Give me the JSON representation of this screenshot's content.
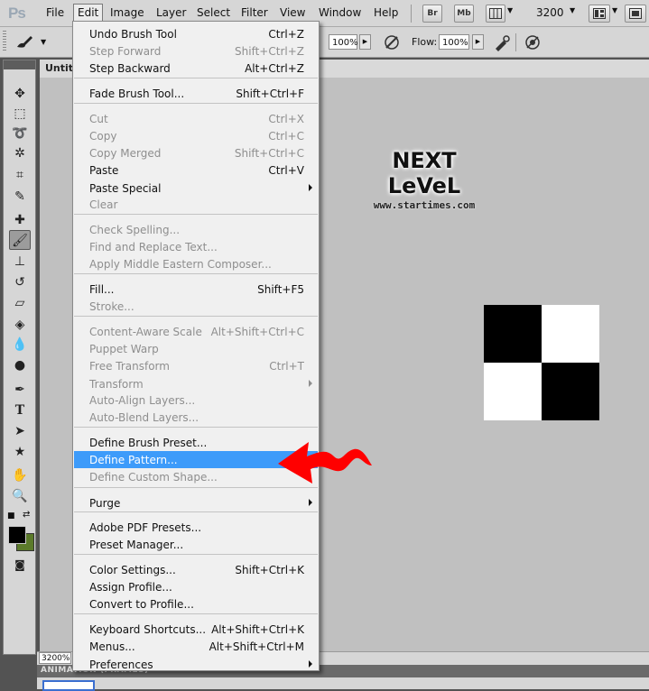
{
  "app": {
    "logo": "Ps"
  },
  "menubar": {
    "items": [
      "File",
      "Edit",
      "Image",
      "Layer",
      "Select",
      "Filter",
      "View",
      "Window",
      "Help"
    ],
    "bridge_button": "Br",
    "minibridge_button": "Mb",
    "zoom_value": "3200"
  },
  "options_bar": {
    "opacity_value": "100%",
    "flow_label": "Flow:",
    "flow_value": "100%"
  },
  "document": {
    "tab_title": "Untitl",
    "zoom_status": "3200%"
  },
  "watermark": {
    "title": "NEXT LeVeL",
    "url": "www.startimes.com"
  },
  "panel": {
    "tab_label": "ANIMATION (FRAMES)"
  },
  "edit_menu": {
    "items": [
      {
        "label": "Undo Brush Tool",
        "shortcut": "Ctrl+Z",
        "enabled": true,
        "submenu": false
      },
      {
        "label": "Step Forward",
        "shortcut": "Shift+Ctrl+Z",
        "enabled": false,
        "submenu": false
      },
      {
        "label": "Step Backward",
        "shortcut": "Alt+Ctrl+Z",
        "enabled": true,
        "submenu": false
      },
      {
        "label": "Fade Brush Tool...",
        "shortcut": "Shift+Ctrl+F",
        "enabled": true,
        "submenu": false
      },
      {
        "label": "Cut",
        "shortcut": "Ctrl+X",
        "enabled": false,
        "submenu": false
      },
      {
        "label": "Copy",
        "shortcut": "Ctrl+C",
        "enabled": false,
        "submenu": false
      },
      {
        "label": "Copy Merged",
        "shortcut": "Shift+Ctrl+C",
        "enabled": false,
        "submenu": false
      },
      {
        "label": "Paste",
        "shortcut": "Ctrl+V",
        "enabled": true,
        "submenu": false
      },
      {
        "label": "Paste Special",
        "shortcut": "",
        "enabled": true,
        "submenu": true
      },
      {
        "label": "Clear",
        "shortcut": "",
        "enabled": false,
        "submenu": false
      },
      {
        "label": "Check Spelling...",
        "shortcut": "",
        "enabled": false,
        "submenu": false
      },
      {
        "label": "Find and Replace Text...",
        "shortcut": "",
        "enabled": false,
        "submenu": false
      },
      {
        "label": "Apply Middle Eastern Composer...",
        "shortcut": "",
        "enabled": false,
        "submenu": false
      },
      {
        "label": "Fill...",
        "shortcut": "Shift+F5",
        "enabled": true,
        "submenu": false
      },
      {
        "label": "Stroke...",
        "shortcut": "",
        "enabled": false,
        "submenu": false
      },
      {
        "label": "Content-Aware Scale",
        "shortcut": "Alt+Shift+Ctrl+C",
        "enabled": false,
        "submenu": false
      },
      {
        "label": "Puppet Warp",
        "shortcut": "",
        "enabled": false,
        "submenu": false
      },
      {
        "label": "Free Transform",
        "shortcut": "Ctrl+T",
        "enabled": false,
        "submenu": false
      },
      {
        "label": "Transform",
        "shortcut": "",
        "enabled": false,
        "submenu": true
      },
      {
        "label": "Auto-Align Layers...",
        "shortcut": "",
        "enabled": false,
        "submenu": false
      },
      {
        "label": "Auto-Blend Layers...",
        "shortcut": "",
        "enabled": false,
        "submenu": false
      },
      {
        "label": "Define Brush Preset...",
        "shortcut": "",
        "enabled": true,
        "submenu": false
      },
      {
        "label": "Define Pattern...",
        "shortcut": "",
        "enabled": true,
        "submenu": false,
        "highlighted": true
      },
      {
        "label": "Define Custom Shape...",
        "shortcut": "",
        "enabled": false,
        "submenu": false
      },
      {
        "label": "Purge",
        "shortcut": "",
        "enabled": true,
        "submenu": true
      },
      {
        "label": "Adobe PDF Presets...",
        "shortcut": "",
        "enabled": true,
        "submenu": false
      },
      {
        "label": "Preset Manager...",
        "shortcut": "",
        "enabled": true,
        "submenu": false
      },
      {
        "label": "Color Settings...",
        "shortcut": "Shift+Ctrl+K",
        "enabled": true,
        "submenu": false
      },
      {
        "label": "Assign Profile...",
        "shortcut": "",
        "enabled": true,
        "submenu": false
      },
      {
        "label": "Convert to Profile...",
        "shortcut": "",
        "enabled": true,
        "submenu": false
      },
      {
        "label": "Keyboard Shortcuts...",
        "shortcut": "Alt+Shift+Ctrl+K",
        "enabled": true,
        "submenu": false
      },
      {
        "label": "Menus...",
        "shortcut": "Alt+Shift+Ctrl+M",
        "enabled": true,
        "submenu": false
      },
      {
        "label": "Preferences",
        "shortcut": "",
        "enabled": true,
        "submenu": true
      }
    ]
  },
  "colors": {
    "highlight": "#3d9bfa",
    "foreground_swatch": "#000000",
    "background_swatch": "#5b7a2a",
    "annotation_arrow": "#ff0000"
  },
  "icons": {
    "toolbox": [
      "move-icon",
      "marquee-icon",
      "lasso-icon",
      "quick-select-icon",
      "crop-icon",
      "eyedropper-icon",
      "healing-brush-icon",
      "brush-icon",
      "clone-stamp-icon",
      "history-brush-icon",
      "eraser-icon",
      "paint-bucket-icon",
      "blur-icon",
      "dodge-icon",
      "pen-icon",
      "type-icon",
      "path-select-icon",
      "shape-icon",
      "hand-icon",
      "zoom-icon"
    ]
  }
}
